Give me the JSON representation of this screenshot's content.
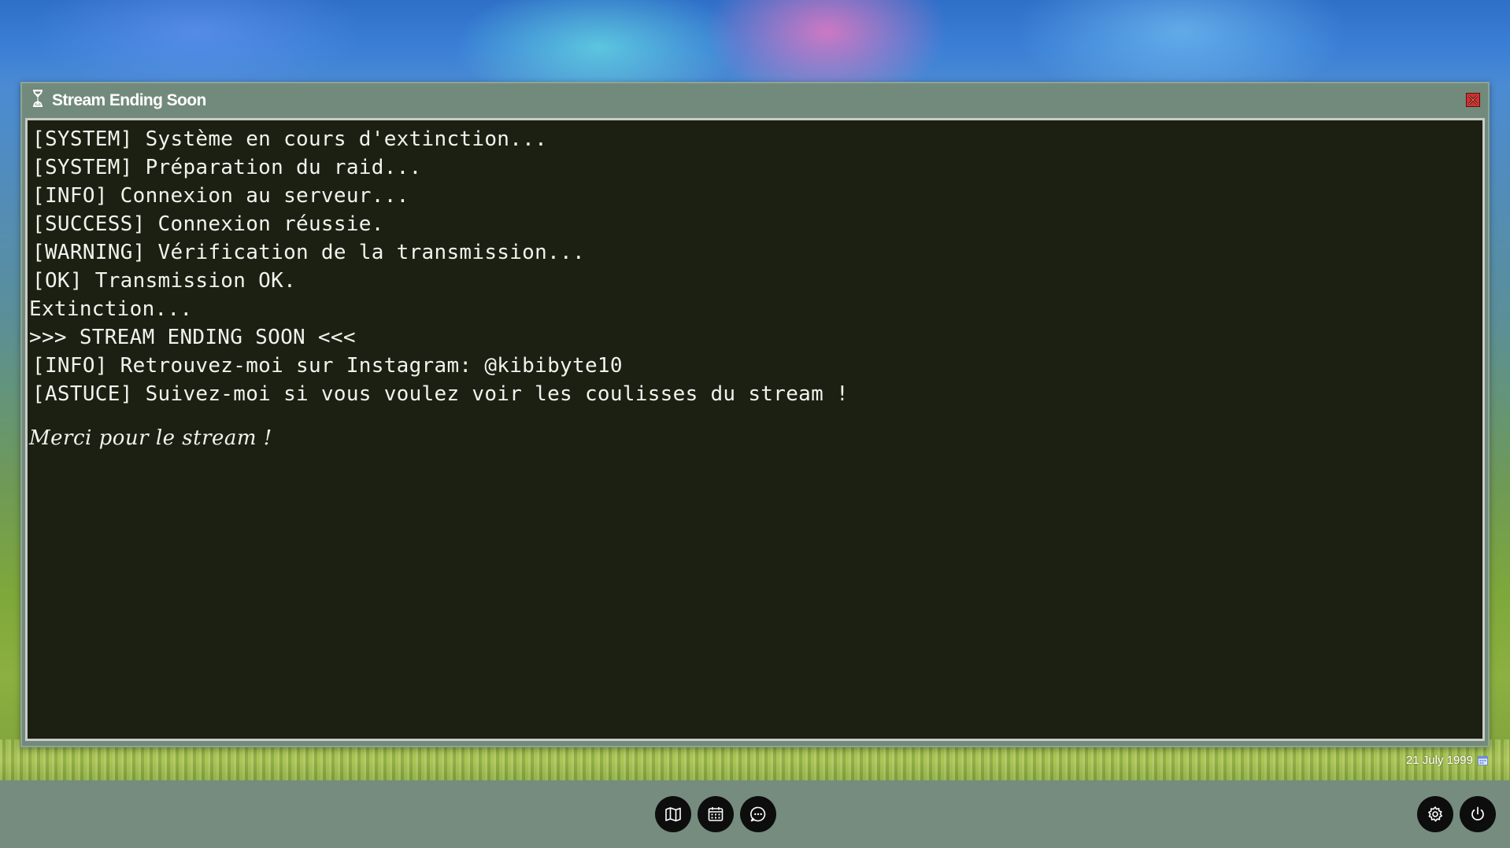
{
  "window": {
    "title": "Stream Ending Soon",
    "icon": "hourglass-icon",
    "close_icon": "close-icon"
  },
  "terminal": {
    "lines": [
      "[SYSTEM] Système en cours d'extinction...",
      "[SYSTEM] Préparation du raid...",
      "[INFO] Connexion au serveur...",
      "[SUCCESS] Connexion réussie.",
      "[WARNING] Vérification de la transmission...",
      "[OK] Transmission OK.",
      "Extinction...",
      ">>> STREAM ENDING SOON <<<",
      "[INFO] Retrouvez-moi sur Instagram: @kibibyte10",
      "[ASTUCE] Suivez-moi si vous voulez voir les coulisses du stream !"
    ],
    "final_message": "Merci pour le stream !"
  },
  "date": {
    "text": "21 July 1999",
    "icon": "calendar-mini-icon"
  },
  "taskbar": {
    "center_buttons": [
      "map-icon",
      "calendar-icon",
      "chat-icon"
    ],
    "right_buttons": [
      "settings-icon",
      "power-icon"
    ]
  },
  "colors": {
    "window_frame": "#728a7c",
    "terminal_bg": "#1c2012",
    "terminal_text": "#f2f2ee",
    "taskbar": "#758c7e",
    "close_button": "#d2312e"
  }
}
